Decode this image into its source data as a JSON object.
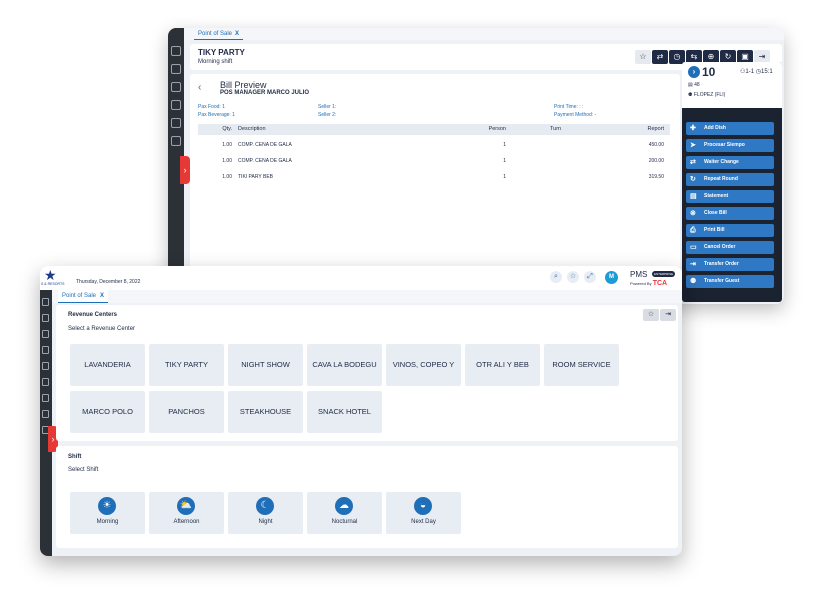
{
  "back_window": {
    "tab": {
      "label": "Point of Sale",
      "close": "X"
    },
    "header": {
      "title": "TIKY PARTY",
      "shift": "Morning shift"
    },
    "toolbar_icons": [
      "star-icon",
      "swap-icon",
      "clock-icon",
      "transfer-icon",
      "merge-icon",
      "refresh-icon",
      "save-icon",
      "exit-icon"
    ],
    "bill": {
      "title": "Bill Preview",
      "subtitle": "POS MANAGER MARCO JULIO",
      "pax_food": "Pax Food:  1",
      "pax_beverage": "Pax Beverage:  1",
      "seller1": "Seller 1:",
      "seller2": "Seller 2:",
      "print_time": "Print Time:  : :",
      "payment_method": "Payment Method:  -",
      "columns": {
        "qty": "Qty.",
        "description": "Description",
        "person": "Person",
        "turn": "Turn",
        "report": "Report"
      },
      "rows": [
        {
          "qty": "1.00",
          "description": "COMP. CENA DE GALA",
          "person": "1",
          "turn": "",
          "report": "450.00"
        },
        {
          "qty": "1.00",
          "description": "COMP. CENA DE GALA",
          "person": "1",
          "turn": "",
          "report": "200.00"
        },
        {
          "qty": "1.00",
          "description": "TIKI PARY BEB",
          "person": "1",
          "turn": "",
          "report": "319.50"
        }
      ]
    },
    "side": {
      "number": "10",
      "pax": "1-1",
      "time": "15:1",
      "room": "48",
      "guest": "FLOPEZ (FLI)",
      "actions": [
        "Add Dish",
        "Procesar Siempo",
        "Waiter Change",
        "Repeat Round",
        "Statement",
        "Close Bill",
        "Print Bill",
        "Cancel Order",
        "Transfer Order",
        "Transfer Guest"
      ]
    }
  },
  "front_window": {
    "logo_text": "S & RESORTS",
    "date": "Thursday, December 8, 2022",
    "avatar": "M",
    "brand": {
      "pms": "PMS",
      "badge": "ENTERPRISE",
      "powered": "Powered By",
      "tca": "TCA"
    },
    "tab": {
      "label": "Point of Sale",
      "close": "X"
    },
    "revenue": {
      "title": "Revenue Centers",
      "subtitle": "Select a Revenue Center",
      "centers": [
        "LAVANDERIA",
        "TIKY PARTY",
        "NIGHT SHOW",
        "CAVA LA BODEGU",
        "VINOS, COPEO Y",
        "OTR ALI Y BEB",
        "ROOM SERVICE",
        "MARCO POLO",
        "PANCHOS",
        "STEAKHOUSE",
        "SNACK HOTEL"
      ]
    },
    "shift": {
      "title": "Shift",
      "subtitle": "Select Shift",
      "options": [
        "Morning",
        "Afternoon",
        "Night",
        "Nocturnal",
        "Next Day"
      ]
    }
  }
}
